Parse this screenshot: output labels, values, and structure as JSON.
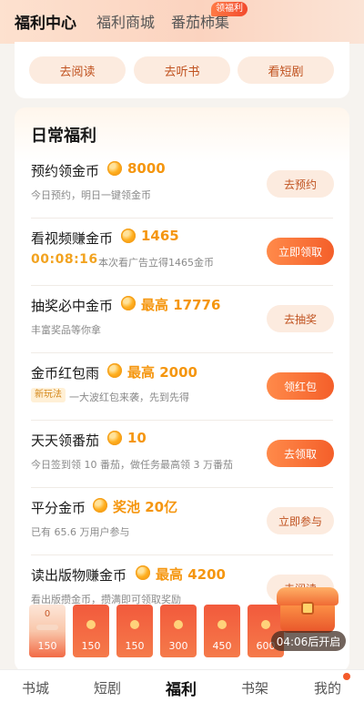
{
  "header": {
    "tabs": [
      {
        "label": "福利中心",
        "active": true
      },
      {
        "label": "福利商城",
        "active": false
      },
      {
        "label": "番茄柿集",
        "active": false
      }
    ],
    "badge": "领福利"
  },
  "quick_actions": [
    "去阅读",
    "去听书",
    "看短剧"
  ],
  "daily": {
    "title": "日常福利",
    "rows": [
      {
        "title": "预约领金币",
        "amount": "8000",
        "sub": "今日预约，明日一键领金币",
        "button": "去预约"
      },
      {
        "title": "看视频赚金币",
        "amount": "1465",
        "timer": "00:08:16",
        "sub": "本次看广告立得1465金币",
        "button": "立即领取"
      },
      {
        "title": "抽奖必中金币",
        "amount": "最高 17776",
        "sub": "丰富奖品等你拿",
        "button": "去抽奖"
      },
      {
        "title": "金币红包雨",
        "amount": "最高 2000",
        "tag": "新玩法",
        "sub": "一大波红包来袭，先到先得",
        "button": "领红包"
      },
      {
        "title": "天天领番茄",
        "amount": "10",
        "sub": "今日签到领 10 番茄，做任务最高领 3 万番茄",
        "button": "去领取"
      },
      {
        "title": "平分金币",
        "amount": "奖池 20亿",
        "sub": "已有 65.6 万用户参与",
        "button": "立即参与"
      },
      {
        "title": "读出版物赚金币",
        "amount": "最高 4200",
        "sub": "看出版攒金币，攒满即可领取奖励",
        "button": "去阅读"
      }
    ]
  },
  "envelopes": {
    "first_top": "0",
    "values": [
      "150",
      "150",
      "150",
      "300",
      "450",
      "600"
    ]
  },
  "chest": {
    "label": "04:06后开启"
  },
  "bottom_nav": [
    {
      "label": "书城",
      "active": false
    },
    {
      "label": "短剧",
      "active": false
    },
    {
      "label": "福利",
      "active": true
    },
    {
      "label": "书架",
      "active": false
    },
    {
      "label": "我的",
      "active": false
    }
  ],
  "colors": {
    "accent": "#f45f2a",
    "coin": "#f5960f",
    "pill_bg": "#fcebdf"
  }
}
